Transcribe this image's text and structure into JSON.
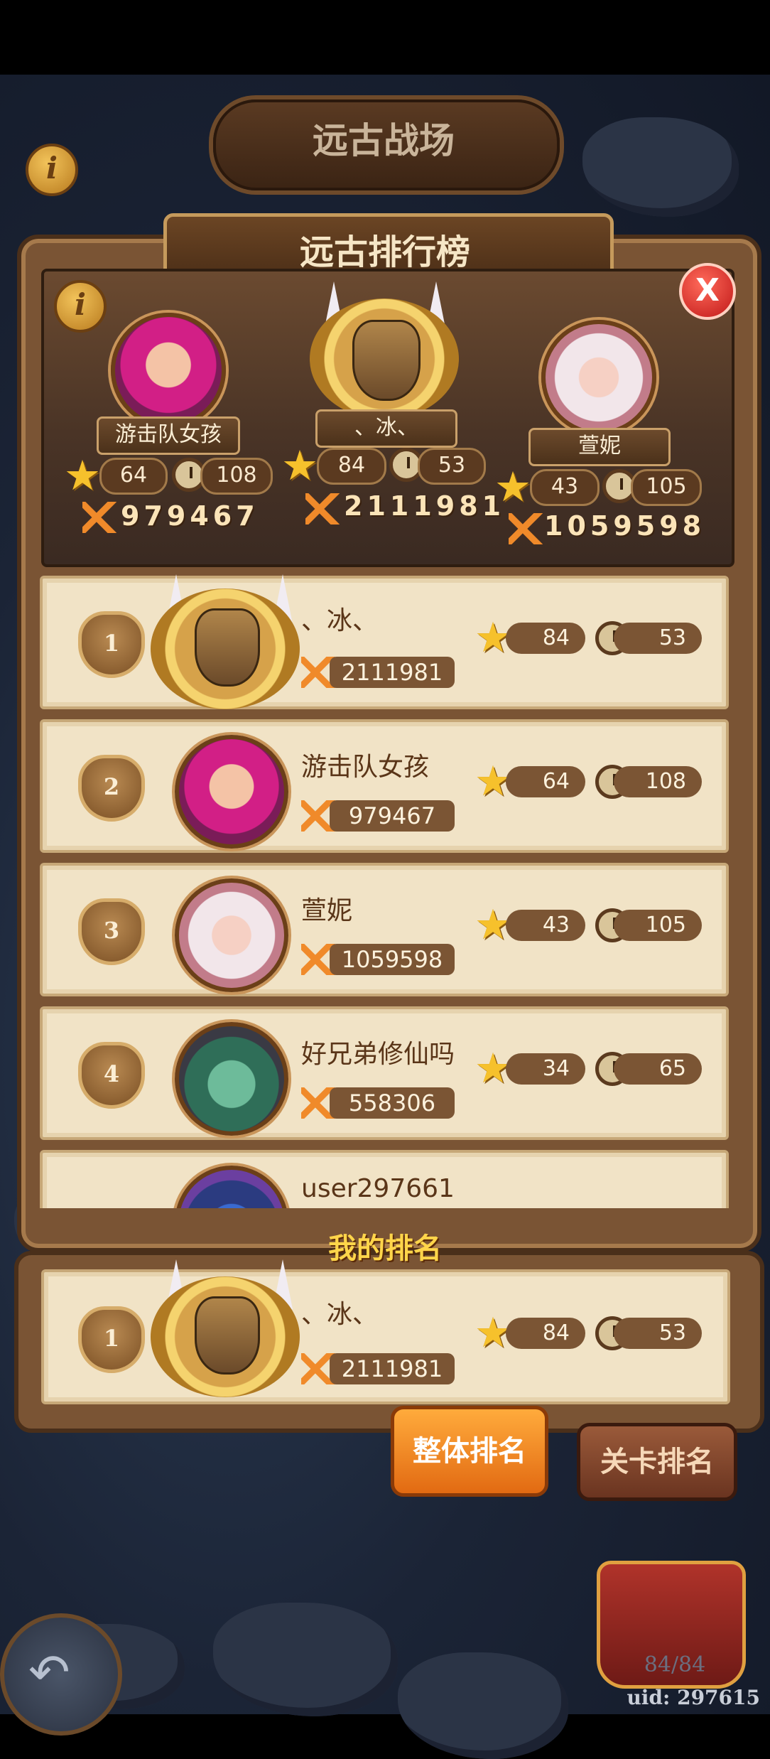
{
  "top": {
    "title": "远古战场",
    "info_glyph": "i"
  },
  "panel": {
    "title": "远古排行榜",
    "info_glyph": "i",
    "close_glyph": "X"
  },
  "podium": [
    {
      "name": "游击队女孩",
      "stars": "64",
      "time": "108",
      "score": "979467",
      "avatar": "pink-hair-girl"
    },
    {
      "name": "、冰、",
      "stars": "84",
      "time": "53",
      "score": "2111981",
      "avatar": "shield-medal"
    },
    {
      "name": "萱妮",
      "stars": "43",
      "time": "105",
      "score": "1059598",
      "avatar": "white-hair-elf"
    }
  ],
  "rows": [
    {
      "rank": "1",
      "name": "、冰、",
      "score": "2111981",
      "stars": "84",
      "time": "53",
      "avatar": "shield-medal"
    },
    {
      "rank": "2",
      "name": "游击队女孩",
      "score": "979467",
      "stars": "64",
      "time": "108",
      "avatar": "pink-hair-girl"
    },
    {
      "rank": "3",
      "name": "萱妮",
      "score": "1059598",
      "stars": "43",
      "time": "105",
      "avatar": "white-hair-elf"
    },
    {
      "rank": "4",
      "name": "好兄弟修仙吗",
      "score": "558306",
      "stars": "34",
      "time": "65",
      "avatar": "green-dragon"
    },
    {
      "rank": "",
      "name": "user297661",
      "score": "",
      "stars": "",
      "time": "",
      "avatar": "blue-dragon"
    }
  ],
  "my_rank": {
    "title": "我的排名",
    "rank": "1",
    "name": "、冰、",
    "score": "2111981",
    "stars": "84",
    "time": "53"
  },
  "tabs": {
    "overall": "整体排名",
    "stage": "关卡排名",
    "active": "overall"
  },
  "footer": {
    "chest_progress": "84/84",
    "uid": "uid: 297615"
  },
  "colors": {
    "star": "#f6c12c",
    "score_swords": "#f08a2a",
    "active_tab": "#f08a1e",
    "close": "#d42020"
  }
}
